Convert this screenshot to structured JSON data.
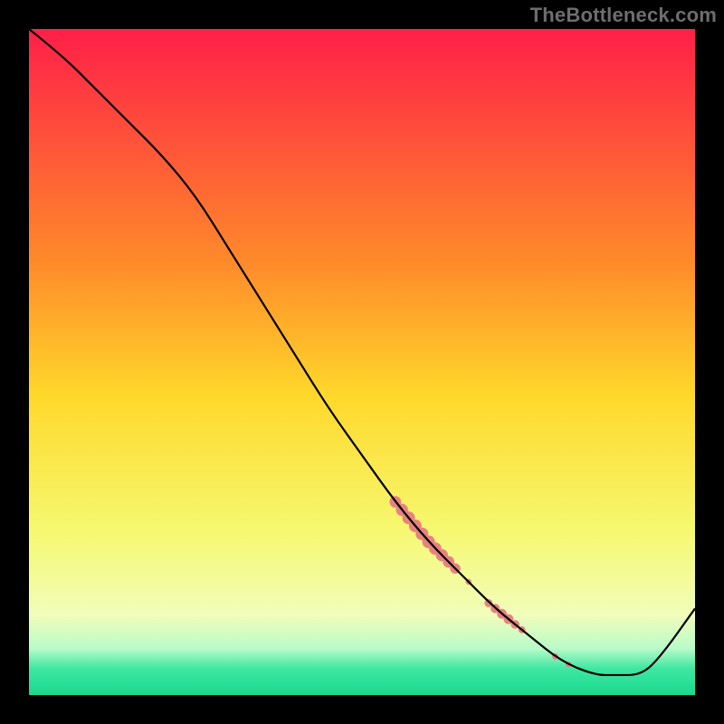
{
  "watermark": "TheBottleneck.com",
  "chart_data": {
    "type": "line",
    "title": "",
    "xlabel": "",
    "ylabel": "",
    "xlim": [
      0,
      100
    ],
    "ylim": [
      0,
      100
    ],
    "grid": false,
    "gradient_stops": [
      {
        "offset": 0,
        "color": "#ff1f48"
      },
      {
        "offset": 35,
        "color": "#ff8a2a"
      },
      {
        "offset": 55,
        "color": "#ffd82a"
      },
      {
        "offset": 75,
        "color": "#f6f86f"
      },
      {
        "offset": 88,
        "color": "#f1fdba"
      },
      {
        "offset": 93,
        "color": "#b9fbc9"
      },
      {
        "offset": 96,
        "color": "#3fe7a2"
      },
      {
        "offset": 100,
        "color": "#18d98e"
      }
    ],
    "series": [
      {
        "name": "curve",
        "color": "#000000",
        "x": [
          0,
          5,
          10,
          15,
          20,
          25,
          30,
          35,
          40,
          45,
          50,
          55,
          60,
          65,
          70,
          75,
          80,
          85,
          88,
          92,
          95,
          100
        ],
        "values": [
          100,
          96,
          91,
          86,
          81,
          75,
          67,
          59,
          51,
          43,
          36,
          29,
          23,
          18,
          13,
          9,
          5,
          3,
          3,
          3,
          6,
          13
        ]
      }
    ],
    "markers": {
      "name": "highlight-segment",
      "color": "#e98181",
      "points": [
        {
          "x": 55,
          "y": 29,
          "r": 4.0
        },
        {
          "x": 56,
          "y": 27.8,
          "r": 4.2
        },
        {
          "x": 57,
          "y": 26.6,
          "r": 4.4
        },
        {
          "x": 58,
          "y": 25.4,
          "r": 4.4
        },
        {
          "x": 59,
          "y": 24.2,
          "r": 4.4
        },
        {
          "x": 60,
          "y": 23.0,
          "r": 4.4
        },
        {
          "x": 61,
          "y": 22.0,
          "r": 4.3
        },
        {
          "x": 62,
          "y": 21.0,
          "r": 4.2
        },
        {
          "x": 63,
          "y": 20.0,
          "r": 4.0
        },
        {
          "x": 64,
          "y": 19.0,
          "r": 3.6
        },
        {
          "x": 66,
          "y": 17.0,
          "r": 2.0
        },
        {
          "x": 69,
          "y": 13.8,
          "r": 2.8
        },
        {
          "x": 70,
          "y": 13.0,
          "r": 3.2
        },
        {
          "x": 71,
          "y": 12.2,
          "r": 3.4
        },
        {
          "x": 72,
          "y": 11.4,
          "r": 3.4
        },
        {
          "x": 73,
          "y": 10.6,
          "r": 3.0
        },
        {
          "x": 74,
          "y": 9.8,
          "r": 2.4
        },
        {
          "x": 79,
          "y": 5.8,
          "r": 2.2
        },
        {
          "x": 81,
          "y": 4.6,
          "r": 2.0
        }
      ]
    }
  }
}
